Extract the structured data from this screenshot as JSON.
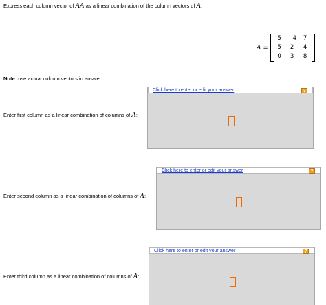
{
  "intro": {
    "before": "Express each column vector of ",
    "var1": "AA",
    "middle": " as a linear combination of the column vectors of ",
    "var2": "A",
    "after": "."
  },
  "matrix": {
    "label": "A",
    "equals": "=",
    "rows": [
      [
        "5",
        "−4",
        "7"
      ],
      [
        "5",
        "2",
        "4"
      ],
      [
        "0",
        "3",
        "8"
      ]
    ]
  },
  "note": {
    "bold": "Note:",
    "text": " use actual column vectors in answer."
  },
  "questions": [
    {
      "prompt": "Enter first column as a linear combination of columns of ",
      "var": "A",
      "colon": ":",
      "link": "Click here to enter or edit your answer",
      "help": "?"
    },
    {
      "prompt": "Enter second column as a linear combination of columns of ",
      "var": "A",
      "colon": ":",
      "link": "Click here to enter or edit your answer",
      "help": "?"
    },
    {
      "prompt": "Enter third column as a linear combination of columns of ",
      "var": "A",
      "colon": ":",
      "link": "Click here to enter or edit your answer",
      "help": "?"
    }
  ]
}
